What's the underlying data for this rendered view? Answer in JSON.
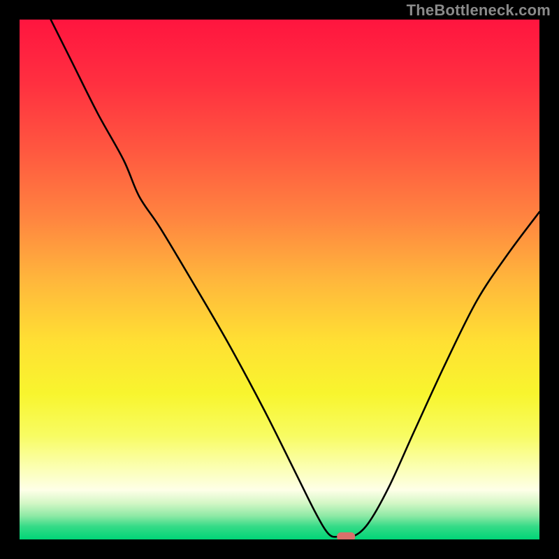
{
  "watermark": "TheBottleneck.com",
  "chart_data": {
    "type": "line",
    "title": "",
    "xlabel": "",
    "ylabel": "",
    "xlim": [
      0,
      100
    ],
    "ylim": [
      0,
      100
    ],
    "series": [
      {
        "name": "bottleneck-curve",
        "x": [
          6,
          10,
          15,
          20,
          23,
          27,
          33,
          40,
          47,
          53,
          57,
          59.5,
          61.5,
          64,
          67,
          71,
          76,
          82,
          88,
          94,
          100
        ],
        "y": [
          100,
          92,
          82,
          73,
          66,
          60,
          50,
          38,
          25,
          13,
          5,
          1,
          0.5,
          0.5,
          3,
          10,
          21,
          34,
          46,
          55,
          63
        ]
      }
    ],
    "marker": {
      "x": 62.8,
      "y": 0.5,
      "color": "#d9706b"
    },
    "gradient_stops": [
      {
        "offset": 0.0,
        "color": "#ff153f"
      },
      {
        "offset": 0.12,
        "color": "#ff2f40"
      },
      {
        "offset": 0.25,
        "color": "#ff5740"
      },
      {
        "offset": 0.38,
        "color": "#ff8440"
      },
      {
        "offset": 0.5,
        "color": "#ffb63c"
      },
      {
        "offset": 0.62,
        "color": "#ffe033"
      },
      {
        "offset": 0.72,
        "color": "#f8f52e"
      },
      {
        "offset": 0.8,
        "color": "#f8fc62"
      },
      {
        "offset": 0.86,
        "color": "#fbffb0"
      },
      {
        "offset": 0.905,
        "color": "#feffe8"
      },
      {
        "offset": 0.93,
        "color": "#d4f7c6"
      },
      {
        "offset": 0.955,
        "color": "#8de9a5"
      },
      {
        "offset": 0.975,
        "color": "#35db87"
      },
      {
        "offset": 1.0,
        "color": "#00d577"
      }
    ]
  }
}
